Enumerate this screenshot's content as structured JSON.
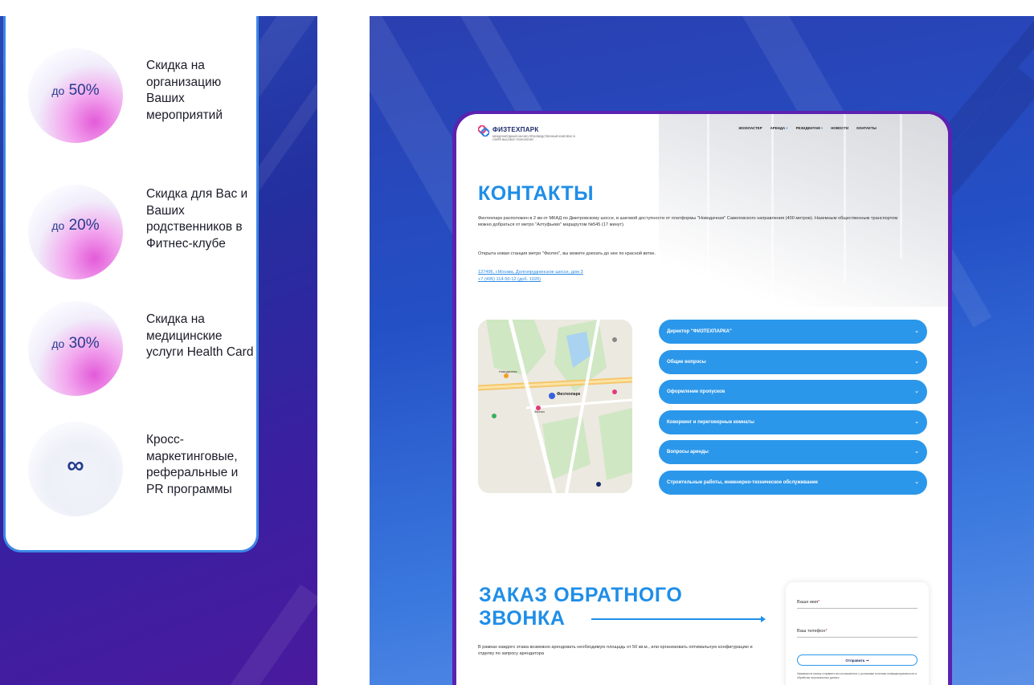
{
  "perks": [
    {
      "prefix": "до",
      "value": "50%",
      "text": "Скидка на организацию Ваших мероприятий"
    },
    {
      "prefix": "до",
      "value": "20%",
      "text": "Скидка для Вас и Ваших родственников в Фитнес-клубе"
    },
    {
      "prefix": "до",
      "value": "30%",
      "text": "Скидка на медицинские услуги Health Card"
    },
    {
      "prefix": "",
      "value": "∞",
      "text": "Кросс-маркетинговые, реферальные и PR программы"
    }
  ],
  "site": {
    "logo_name": "ФИЗТЕХПАРК",
    "logo_sub": "МЕЖДУНАРОДНЫЙ НАУЧНО-ПРОИЗВОДСТВЕННЫЙ КОМПЛЕКС В СФЕРЕ ВЫСОКИХ ТЕХНОЛОГИЙ",
    "nav": [
      "ЭКОКЛАСТЕР",
      "АРЕНДА",
      "РЕЗИДЕНТАМ",
      "НОВОСТИ",
      "КОНТАКТЫ"
    ],
    "title": "КОНТАКТЫ",
    "para1": "Физтехпарк расположен в 2 км от МКАД по Дмитровскому шоссе, в шаговой доступности от платформы \"Новодачная\" Савеловского направления (400 метров). Наземным общественным транспортом можно добраться от метро \"Алтуфьево\" маршрутом №545 (17 минут).",
    "para2": "Открыта новая станция метро \"Физтех\", вы можете доехать до нее по красной ветке.",
    "address": "127495, г.Москва, Долгопрудненское шоссе, дом 3",
    "phone": "+7 (495) 114-50-12 (доб. 1020)",
    "map_labels": {
      "main": "Физтехпарк",
      "poi1": "Новодачная",
      "poi2": "Физтех"
    },
    "accordion": [
      "Директор \"ФИЗТЕХПАРКА\"",
      "Общие вопросы",
      "Оформление пропусков",
      "Коворкинг и переговорные комнаты",
      "Вопросы аренды",
      "Строительные работы, инженерно-техническое обслуживание"
    ],
    "callback_title": "ЗАКАЗ ОБРАТНОГО ЗВОНКА",
    "callback_text": "В рамках каждого этажа возможно арендовать необходимую площадь от 50 кв.м., или организовать оптимальную конфигурацию и отделку по запросу арендатора",
    "form": {
      "name_label": "Ваше имя",
      "phone_label": "Ваш телефон",
      "submit": "Отправить",
      "consent": "Нажимая на кнопку отправить вы соглашаетесь с условиями политики конфиденциальности и обработки персональных данных"
    }
  }
}
